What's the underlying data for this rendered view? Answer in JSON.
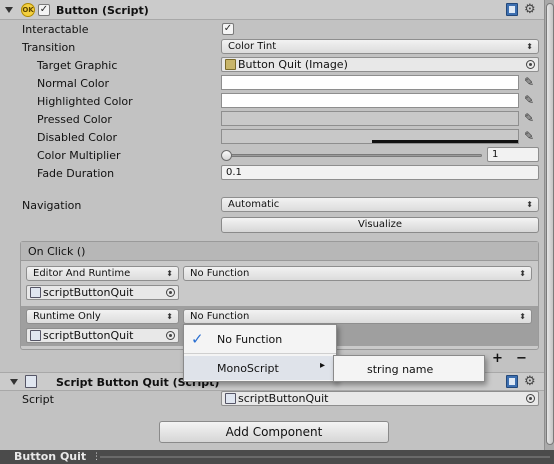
{
  "button_component": {
    "title": "Button (Script)",
    "enabled": true,
    "fields": {
      "interactable": {
        "label": "Interactable",
        "checked": true
      },
      "transition": {
        "label": "Transition",
        "value": "Color Tint"
      },
      "target_graphic": {
        "label": "Target Graphic",
        "value": "Button Quit (Image)"
      },
      "normal_color": {
        "label": "Normal Color"
      },
      "highlighted_color": {
        "label": "Highlighted Color"
      },
      "pressed_color": {
        "label": "Pressed Color"
      },
      "disabled_color": {
        "label": "Disabled Color"
      },
      "color_multiplier": {
        "label": "Color Multiplier",
        "value": "1"
      },
      "fade_duration": {
        "label": "Fade Duration",
        "value": "0.1"
      },
      "navigation": {
        "label": "Navigation",
        "value": "Automatic"
      },
      "visualize_button": "Visualize"
    },
    "colors": {
      "normal": "#ffffff",
      "highlighted": "#ffffff",
      "pressed": "#c8c8c8",
      "disabled": "#c8c8c8"
    }
  },
  "on_click": {
    "title": "On Click ()",
    "entries": [
      {
        "call_state": "Editor And Runtime",
        "function": "No Function",
        "object": "scriptButtonQuit"
      },
      {
        "call_state": "Runtime Only",
        "function": "No Function",
        "object": "scriptButtonQuit"
      }
    ],
    "add_label": "+",
    "remove_label": "−"
  },
  "function_menu": {
    "items": [
      {
        "label": "No Function",
        "checked": true
      },
      {
        "label": "MonoScript",
        "has_submenu": true
      }
    ],
    "submenu": {
      "items": [
        "string name"
      ]
    }
  },
  "script_component": {
    "title": "Script Button Quit (Script)",
    "script_label": "Script",
    "script_value": "scriptButtonQuit"
  },
  "add_component_button": "Add Component",
  "bottom_bar": {
    "title": "Button Quit"
  }
}
